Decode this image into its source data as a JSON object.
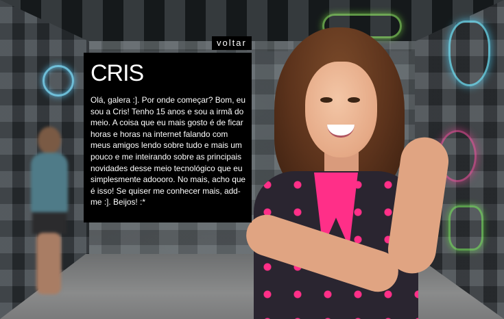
{
  "nav": {
    "back_label": "voltar"
  },
  "profile": {
    "name": "CRIS",
    "bio": "Olá, galera :]. Por onde começar? Bom, eu sou a Cris! Tenho 15 anos e sou a irmã do meio. A coisa que eu mais gosto é de ficar horas e horas na internet falando com meus amigos lendo sobre tudo e mais um pouco e me inteirando sobre as principais novidades desse meio tecnológico que eu simplesmente adoooro. No mais, acho que é isso! Se quiser me conhecer mais, add-me :]. Beijos! :*"
  },
  "colors": {
    "panel_bg": "#000000",
    "panel_text": "#ffffff",
    "shirt_accent": "#ff2f88",
    "neon_blue": "#6fe8ff",
    "neon_green": "#9dff6a",
    "neon_pink": "#ff4fa3"
  }
}
